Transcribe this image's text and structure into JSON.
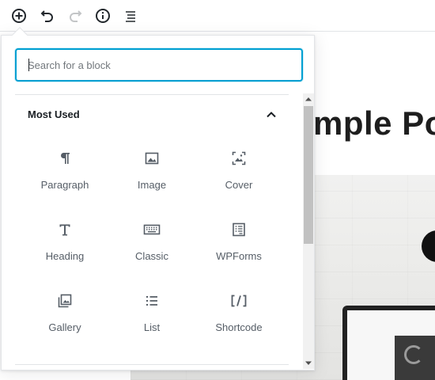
{
  "toolbar": {
    "buttons": [
      {
        "name": "add-block-button",
        "icon": "plus-circle-icon"
      },
      {
        "name": "undo-button",
        "icon": "undo-icon"
      },
      {
        "name": "redo-button",
        "icon": "redo-icon"
      },
      {
        "name": "info-button",
        "icon": "info-icon"
      },
      {
        "name": "block-navigation-button",
        "icon": "list-icon"
      }
    ]
  },
  "editor": {
    "post_title_visible": "mple Po"
  },
  "inserter": {
    "search": {
      "placeholder": "Search for a block",
      "value": ""
    },
    "panel": {
      "title": "Most Used",
      "expanded": true,
      "blocks": [
        {
          "label": "Paragraph",
          "icon": "paragraph-icon"
        },
        {
          "label": "Image",
          "icon": "image-icon"
        },
        {
          "label": "Cover",
          "icon": "cover-icon"
        },
        {
          "label": "Heading",
          "icon": "heading-icon"
        },
        {
          "label": "Classic",
          "icon": "keyboard-icon"
        },
        {
          "label": "WPForms",
          "icon": "wpforms-icon"
        },
        {
          "label": "Gallery",
          "icon": "gallery-icon"
        },
        {
          "label": "List",
          "icon": "list-icon"
        },
        {
          "label": "Shortcode",
          "icon": "shortcode-icon"
        }
      ]
    }
  },
  "colors": {
    "focus_border": "#00a0d2",
    "icon": "#555d66",
    "text_dark": "#191e23",
    "divider": "#e2e4e7"
  }
}
